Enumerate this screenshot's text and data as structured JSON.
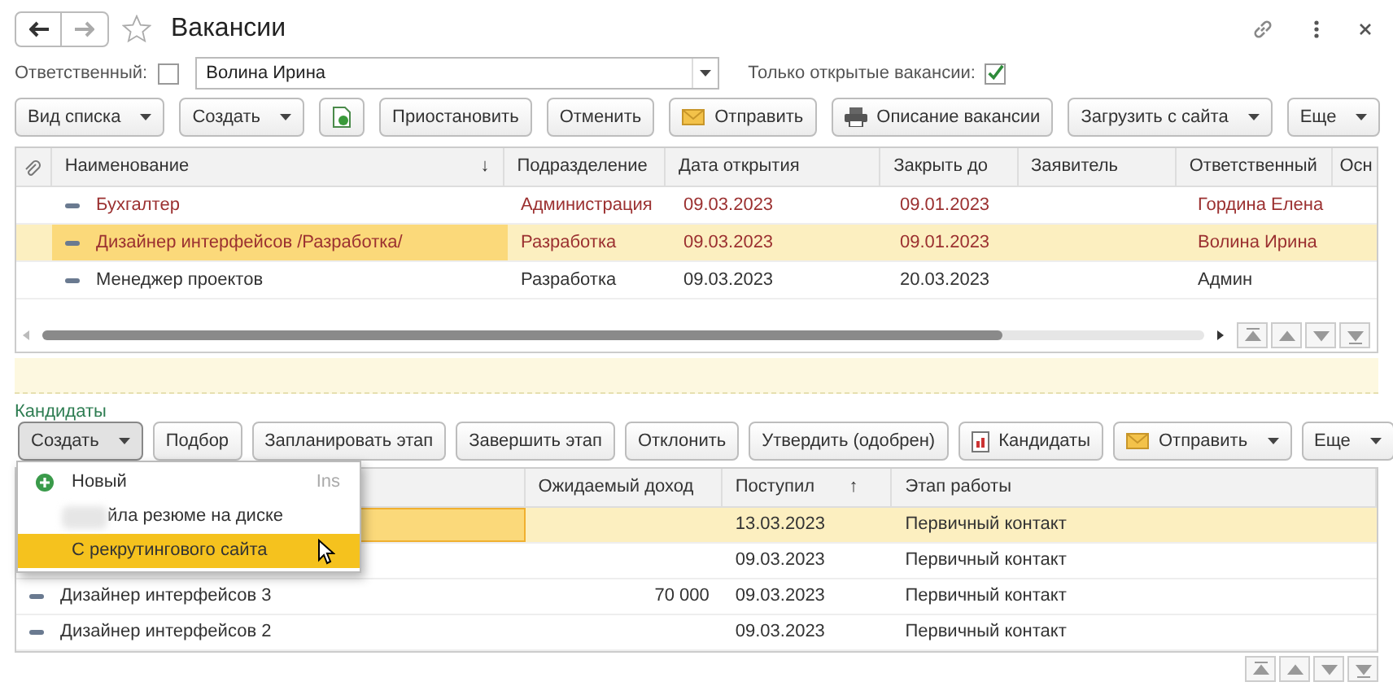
{
  "window": {
    "title": "Вакансии"
  },
  "filter": {
    "responsible_label": "Ответственный:",
    "responsible_checked": false,
    "responsible_value": "Волина Ирина",
    "open_only_label": "Только открытые вакансии:",
    "open_only_checked": true
  },
  "toolbar": [
    {
      "kind": "menu",
      "label": "Вид списка"
    },
    {
      "kind": "menu",
      "label": "Создать"
    },
    {
      "kind": "copy"
    },
    {
      "kind": "text",
      "label": "Приостановить"
    },
    {
      "kind": "text",
      "label": "Отменить"
    },
    {
      "kind": "mail",
      "label": "Отправить"
    },
    {
      "kind": "print",
      "label": "Описание вакансии"
    },
    {
      "kind": "menu",
      "label": "Загрузить с сайта"
    },
    {
      "kind": "menu",
      "label": "Еще"
    }
  ],
  "vacancies": {
    "columns": [
      {
        "label": "Наименование",
        "sort": "↓"
      },
      {
        "label": "Подразделение"
      },
      {
        "label": "Дата открытия"
      },
      {
        "label": "Закрыть до"
      },
      {
        "label": "Заявитель"
      },
      {
        "label": "Ответственный"
      },
      {
        "label": "Осн"
      }
    ],
    "rows": [
      {
        "cells": [
          "Бухгалтер",
          "Администрация",
          "09.03.2023",
          "09.01.2023",
          "",
          "Гордина Елена"
        ],
        "overdue": true,
        "selected": false
      },
      {
        "cells": [
          "Дизайнер интерфейсов /Разработка/",
          "Разработка",
          "09.03.2023",
          "09.01.2023",
          "",
          "Волина Ирина"
        ],
        "overdue": true,
        "selected": true
      },
      {
        "cells": [
          "Менеджер проектов",
          "Разработка",
          "09.03.2023",
          "20.03.2023",
          "",
          "Админ"
        ],
        "overdue": false,
        "selected": false
      }
    ]
  },
  "candidates": {
    "title": "Кандидаты",
    "toolbar": [
      {
        "kind": "menu",
        "label": "Создать",
        "pressed": true
      },
      {
        "kind": "text",
        "label": "Подбор"
      },
      {
        "kind": "text",
        "label": "Запланировать этап"
      },
      {
        "kind": "text",
        "label": "Завершить этап"
      },
      {
        "kind": "text",
        "label": "Отклонить"
      },
      {
        "kind": "text",
        "label": "Утвердить (одобрен)"
      },
      {
        "kind": "report",
        "label": "Кандидаты"
      },
      {
        "kind": "mail-menu",
        "label": "Отправить"
      },
      {
        "kind": "menu",
        "label": "Еще"
      }
    ],
    "columns": [
      {},
      {
        "label": "Ожидаемый доход"
      },
      {
        "label": "Поступил",
        "sort": "↑"
      },
      {
        "label": "Этап работы"
      }
    ],
    "rows": [
      {
        "cells": [
          "",
          "",
          "13.03.2023",
          "Первичный контакт"
        ],
        "selected": true
      },
      {
        "cells": [
          "",
          "",
          "09.03.2023",
          "Первичный контакт"
        ],
        "selected": false
      },
      {
        "cells": [
          "Дизайнер интерфейсов 3",
          "70 000",
          "09.03.2023",
          "Первичный контакт"
        ],
        "selected": false
      },
      {
        "cells": [
          "Дизайнер интерфейсов 2",
          "",
          "09.03.2023",
          "Первичный контакт"
        ],
        "selected": false
      }
    ],
    "create_menu": [
      {
        "kind": "new",
        "label": "Новый",
        "shortcut": "Ins",
        "selected": false
      },
      {
        "kind": "blurred",
        "label": "йла резюме на диске",
        "selected": false
      },
      {
        "kind": "plain",
        "label": "С рекрутингового сайта",
        "selected": true
      }
    ]
  }
}
